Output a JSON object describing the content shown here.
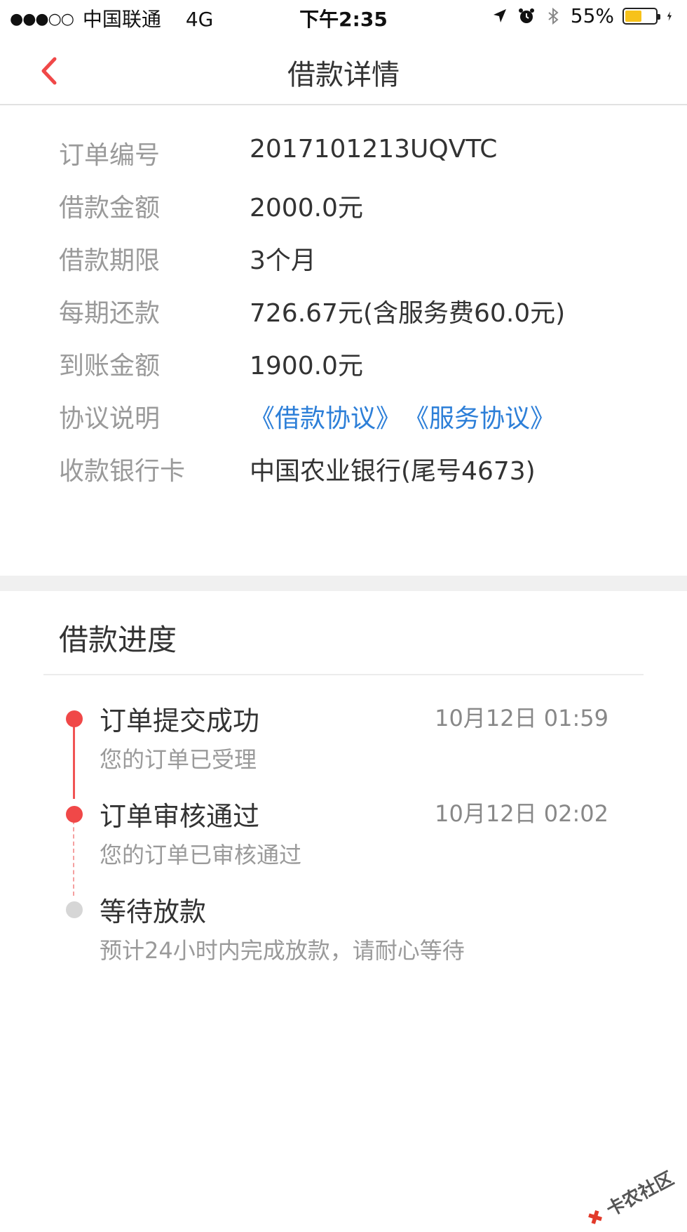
{
  "status_bar": {
    "signal": "●●●○○",
    "carrier": "中国联通",
    "network": "4G",
    "time": "下午2:35",
    "battery_percent": "55%",
    "battery_level": 0.55
  },
  "nav": {
    "title": "借款详情"
  },
  "details": [
    {
      "label": "订单编号",
      "value": "2017101213UQVTC"
    },
    {
      "label": "借款金额",
      "value": "2000.0元"
    },
    {
      "label": "借款期限",
      "value": "3个月"
    },
    {
      "label": "每期还款",
      "value": "726.67元(含服务费60.0元)"
    },
    {
      "label": "到账金额",
      "value": "1900.0元"
    },
    {
      "label": "协议说明",
      "links": [
        "《借款协议》",
        "《服务协议》"
      ]
    },
    {
      "label": "收款银行卡",
      "value": "中国农业银行(尾号4673)"
    }
  ],
  "progress": {
    "title": "借款进度",
    "steps": [
      {
        "title": "订单提交成功",
        "desc": "您的订单已受理",
        "time": "10月12日 01:59",
        "state": "done"
      },
      {
        "title": "订单审核通过",
        "desc": "您的订单已审核通过",
        "time": "10月12日 02:02",
        "state": "done"
      },
      {
        "title": "等待放款",
        "desc": "预计24小时内完成放款，请耐心等待",
        "time": "",
        "state": "pending"
      }
    ]
  },
  "watermark": "卡农社区",
  "colors": {
    "accent": "#f04848",
    "link": "#2d7fd8",
    "label": "#9a9a9a",
    "battery": "#f7c21a"
  }
}
